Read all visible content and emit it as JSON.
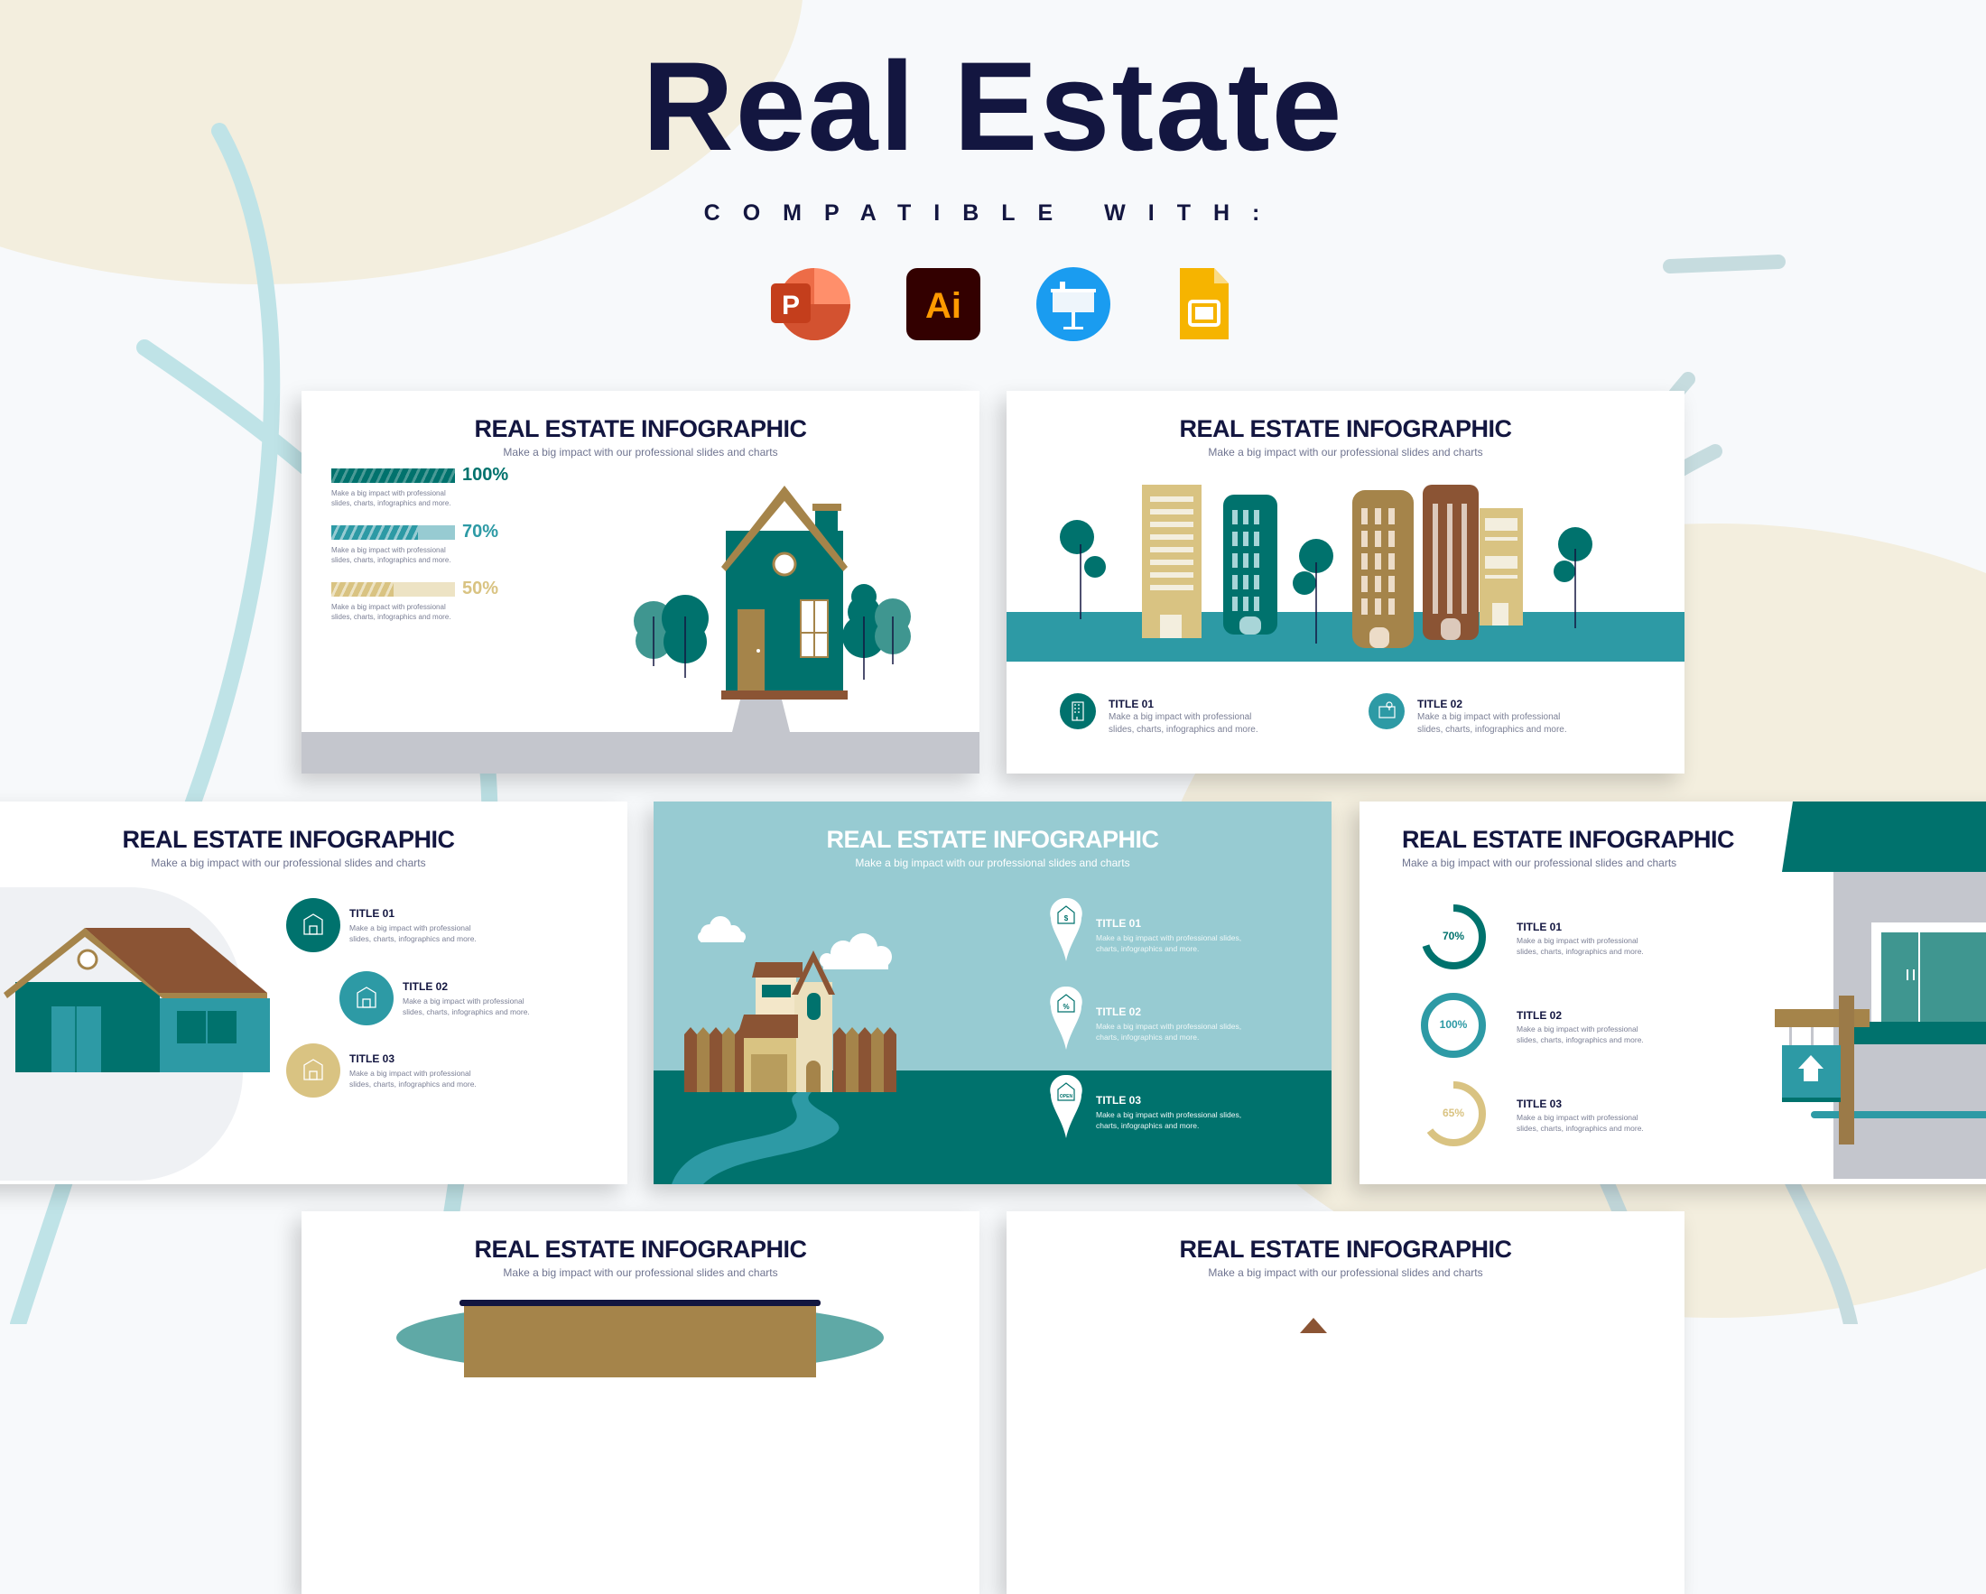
{
  "header": {
    "title": "Real Estate",
    "compatible_label": "COMPATIBLE WITH:",
    "apps": [
      {
        "name": "PowerPoint",
        "icon": "powerpoint-icon",
        "glyph": "P",
        "color": "#d35230"
      },
      {
        "name": "Illustrator",
        "icon": "illustrator-icon",
        "glyph": "Ai",
        "color": "#330000",
        "glyph_color": "#ff9a00"
      },
      {
        "name": "Keynote",
        "icon": "keynote-icon",
        "color": "#1a9cf0"
      },
      {
        "name": "Google Slides",
        "icon": "google-slides-icon",
        "color": "#f6b400"
      }
    ]
  },
  "colors": {
    "navy": "#131640",
    "teal_dark": "#00726d",
    "teal": "#2d9aa5",
    "teal_light": "#97cbd2",
    "gold": "#d9c382",
    "brown": "#8b5434",
    "tan": "#a5844a",
    "beige_bg": "#f3eede",
    "curve": "#bfe3e7"
  },
  "slides": [
    {
      "title": "REAL ESTATE INFOGRAPHIC",
      "subtitle": "Make a big impact with our professional slides and charts",
      "bars": [
        {
          "value": 100,
          "label": "100%",
          "color": "#00726d",
          "desc1": "Make a big impact with professional",
          "desc2": "slides, charts, infographics and more."
        },
        {
          "value": 70,
          "label": "70%",
          "color": "#2d9aa5",
          "desc1": "Make a big impact with professional",
          "desc2": "slides, charts, infographics and more."
        },
        {
          "value": 50,
          "label": "50%",
          "color": "#d9c382",
          "desc1": "Make a big impact with professional",
          "desc2": "slides, charts, infographics and more."
        }
      ]
    },
    {
      "title": "REAL ESTATE INFOGRAPHIC",
      "subtitle": "Make a big impact with our professional slides and charts",
      "items": [
        {
          "title": "TITLE 01",
          "desc1": "Make a big impact with professional",
          "desc2": "slides, charts, infographics and more.",
          "icon": "building-icon"
        },
        {
          "title": "TITLE 02",
          "desc1": "Make a big impact with professional",
          "desc2": "slides, charts, infographics and more.",
          "icon": "map-pin-icon"
        }
      ]
    },
    {
      "title": "REAL ESTATE INFOGRAPHIC",
      "subtitle": "Make a big impact with our professional slides and charts",
      "items": [
        {
          "title": "TITLE 01",
          "desc1": "Make a big impact with professional",
          "desc2": "slides, charts, infographics and more.",
          "icon": "house-icon"
        },
        {
          "title": "TITLE 02",
          "desc1": "Make a big impact with professional",
          "desc2": "slides, charts, infographics and more.",
          "icon": "garage-icon"
        },
        {
          "title": "TITLE 03",
          "desc1": "Make a big impact with professional",
          "desc2": "slides, charts, infographics and more.",
          "icon": "keys-icon"
        }
      ]
    },
    {
      "title": "REAL ESTATE INFOGRAPHIC",
      "subtitle": "Make a big impact with our professional slides and charts",
      "items": [
        {
          "title": "TITLE 01",
          "desc1": "Make a big impact with professional slides,",
          "desc2": "charts, infographics and more.",
          "icon": "house-dollar-icon",
          "glyph": "$"
        },
        {
          "title": "TITLE 02",
          "desc1": "Make a big impact with professional slides,",
          "desc2": "charts, infographics and more.",
          "icon": "house-percent-icon",
          "glyph": "%"
        },
        {
          "title": "TITLE 03",
          "desc1": "Make a big impact with professional slides,",
          "desc2": "charts, infographics and more.",
          "icon": "house-open-icon",
          "glyph": "OPEN"
        }
      ]
    },
    {
      "title": "REAL ESTATE INFOGRAPHIC",
      "subtitle": "Make a big impact with our professional slides and charts",
      "items": [
        {
          "title": "TITLE 01",
          "value": 70,
          "label": "70%",
          "color": "#00726d",
          "desc1": "Make a big impact with professional",
          "desc2": "slides, charts, infographics and more."
        },
        {
          "title": "TITLE 02",
          "value": 100,
          "label": "100%",
          "color": "#2d9aa5",
          "desc1": "Make a big impact with professional",
          "desc2": "slides, charts, infographics and more."
        },
        {
          "title": "TITLE 03",
          "value": 65,
          "label": "65%",
          "color": "#d9c382",
          "desc1": "Make a big impact with professional",
          "desc2": "slides, charts, infographics and more."
        }
      ]
    },
    {
      "title": "REAL ESTATE INFOGRAPHIC",
      "subtitle": "Make a big impact with our professional slides and charts"
    },
    {
      "title": "REAL ESTATE INFOGRAPHIC",
      "subtitle": "Make a big impact with our professional slides and charts"
    }
  ]
}
